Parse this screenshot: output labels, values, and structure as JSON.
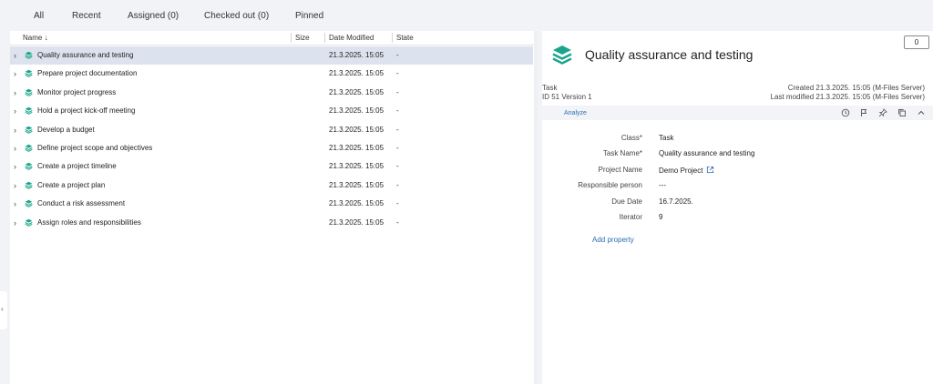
{
  "tabs": [
    "All",
    "Recent",
    "Assigned (0)",
    "Checked out (0)",
    "Pinned"
  ],
  "columns": {
    "name": "Name",
    "sort_indicator": "↓",
    "size": "Size",
    "date": "Date Modified",
    "state": "State"
  },
  "rows": [
    {
      "name": "Quality assurance and testing",
      "date": "21.3.2025. 15:05",
      "state": "-",
      "selected": true
    },
    {
      "name": "Prepare project documentation",
      "date": "21.3.2025. 15:05",
      "state": "-"
    },
    {
      "name": "Monitor project progress",
      "date": "21.3.2025. 15:05",
      "state": "-"
    },
    {
      "name": "Hold a project kick-off meeting",
      "date": "21.3.2025. 15:05",
      "state": "-"
    },
    {
      "name": "Develop a budget",
      "date": "21.3.2025. 15:05",
      "state": "-"
    },
    {
      "name": "Define project scope and objectives",
      "date": "21.3.2025. 15:05",
      "state": "-"
    },
    {
      "name": "Create a project timeline",
      "date": "21.3.2025. 15:05",
      "state": "-"
    },
    {
      "name": "Create a project plan",
      "date": "21.3.2025. 15:05",
      "state": "-"
    },
    {
      "name": "Conduct a risk assessment",
      "date": "21.3.2025. 15:05",
      "state": "-"
    },
    {
      "name": "Assign roles and responsibilities",
      "date": "21.3.2025. 15:05",
      "state": "-"
    }
  ],
  "detail": {
    "title": "Quality assurance and testing",
    "comment_count": "0",
    "object_type": "Task",
    "id_version": "ID 51  Version 1",
    "created": "Created 21.3.2025. 15:05 (M-Files Server)",
    "modified": "Last modified 21.3.2025. 15:05 (M-Files Server)",
    "analyze": "Analyze",
    "properties": [
      {
        "label": "Class*",
        "value": "Task"
      },
      {
        "label": "Task Name*",
        "value": "Quality assurance and testing"
      },
      {
        "label": "Project Name",
        "value": "Demo Project",
        "link": true
      },
      {
        "label": "Responsible person",
        "value": "---"
      },
      {
        "label": "Due Date",
        "value": "16.7.2025."
      },
      {
        "label": "Iterator",
        "value": "9"
      }
    ],
    "add_property": "Add property"
  },
  "icons": {
    "collapse_handle": "chevron-left-icon",
    "object_icon": "layers-icon"
  },
  "colors": {
    "accent": "#1aa58b",
    "link": "#2a6db3",
    "selection": "#dde3ee"
  }
}
